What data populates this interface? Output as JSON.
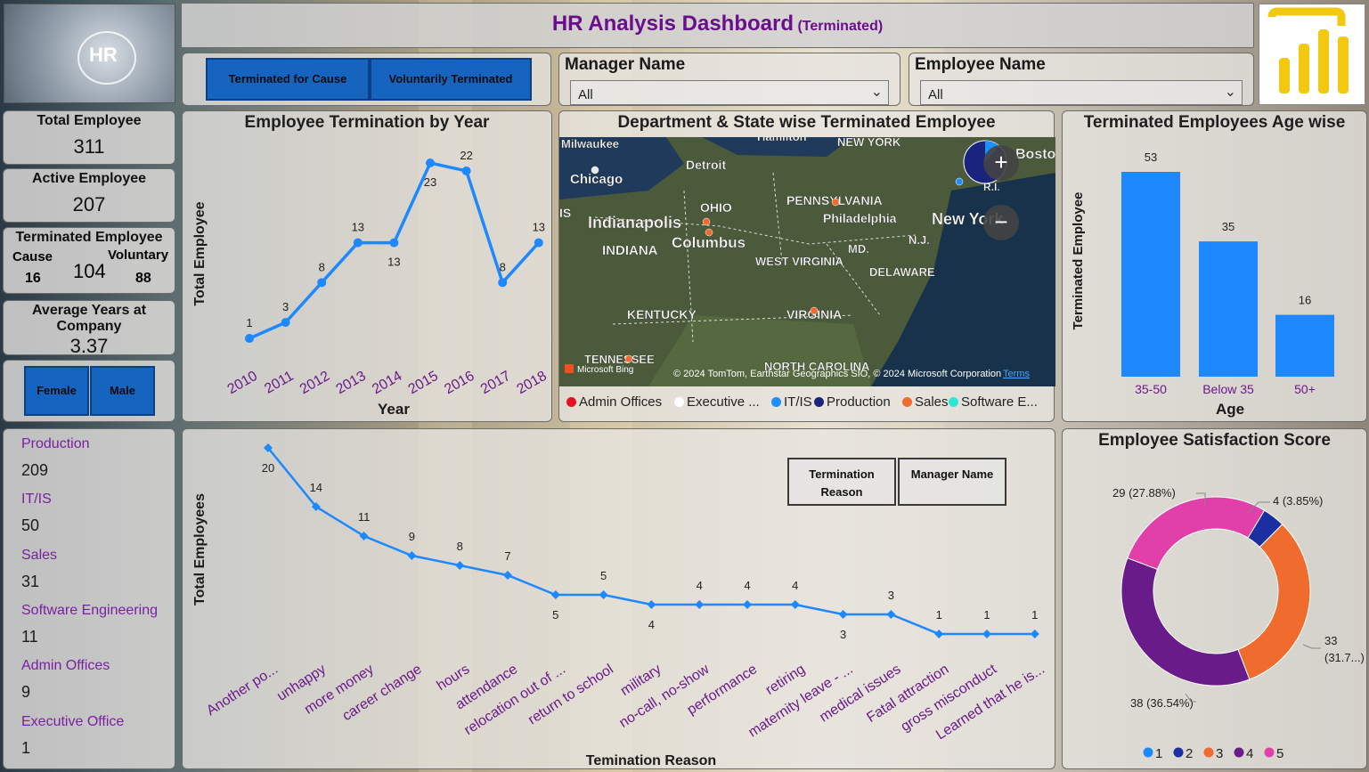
{
  "header": {
    "title": "HR Analysis Dashboard",
    "subtitle": "(Terminated)"
  },
  "logo": {
    "text": "HR"
  },
  "kpis": {
    "total_employee": {
      "label": "Total Employee",
      "value": "311"
    },
    "active_employee": {
      "label": "Active Employee",
      "value": "207"
    },
    "terminated": {
      "label": "Terminated Employee",
      "value": "104",
      "cause_label": "Cause",
      "cause_value": "16",
      "voluntary_label": "Voluntary",
      "voluntary_value": "88"
    },
    "avg_years": {
      "label_1": "Average Years at",
      "label_2": "Company",
      "value": "3.37"
    }
  },
  "buttons": {
    "terminated_for_cause": "Terminated for Cause",
    "voluntarily_terminated": "Voluntarily Terminated",
    "female": "Female",
    "male": "Male"
  },
  "filters": {
    "manager": {
      "label": "Manager Name",
      "value": "All"
    },
    "employee": {
      "label": "Employee Name",
      "value": "All"
    }
  },
  "departments": [
    {
      "name": "Production",
      "value": "209"
    },
    {
      "name": "IT/IS",
      "value": "50"
    },
    {
      "name": "Sales",
      "value": "31"
    },
    {
      "name": "Software Engineering",
      "value": "11"
    },
    {
      "name": "Admin Offices",
      "value": "9"
    },
    {
      "name": "Executive Office",
      "value": "1"
    }
  ],
  "map": {
    "title": "Department & State wise Terminated Employee",
    "labels": [
      "Milwaukee",
      "Hamilton",
      "NEW YORK",
      "Boston",
      "Detroit",
      "Chicago",
      "R.I.",
      "PENNSYLVANIA",
      "OHIO",
      "Philadelphia",
      "Indianapolis",
      "New York",
      "Columbus",
      "N.J.",
      "INDIANA",
      "MD.",
      "WEST VIRGINIA",
      "DELAWARE",
      "KENTUCKY",
      "VIRGINIA",
      "TENNESSEE",
      "NORTH CAROLINA",
      "IS"
    ],
    "attribution": "© 2024 TomTom, Earthstar Geographics SIO, © 2024 Microsoft Corporation",
    "terms": "Terms",
    "bing": "Microsoft Bing",
    "legend": [
      {
        "name": "Admin Offices",
        "color": "#e81123"
      },
      {
        "name": "Executive ...",
        "color": "#ffffff"
      },
      {
        "name": "IT/IS",
        "color": "#1e90ff"
      },
      {
        "name": "Production",
        "color": "#1a237e"
      },
      {
        "name": "Sales",
        "color": "#ef6c2e"
      },
      {
        "name": "Software E...",
        "color": "#2ee6d6"
      }
    ]
  },
  "chart_data": [
    {
      "type": "line",
      "title": "Employee Termination by Year",
      "xlabel": "Year",
      "ylabel": "Total Employee",
      "x": [
        "2010",
        "2011",
        "2012",
        "2013",
        "2014",
        "2015",
        "2016",
        "2017",
        "2018"
      ],
      "values": [
        1,
        3,
        8,
        13,
        13,
        23,
        22,
        8,
        13
      ],
      "color": "#1e88ff"
    },
    {
      "type": "bar",
      "title": "Terminated Employees Age wise",
      "xlabel": "Age",
      "ylabel": "Terminated Employee",
      "categories": [
        "35-50",
        "Below 35",
        "50+"
      ],
      "values": [
        53,
        35,
        16
      ],
      "color": "#1e88ff"
    },
    {
      "type": "line",
      "xlabel": "Temination Reason",
      "ylabel": "Total Employees",
      "x": [
        "Another po...",
        "unhappy",
        "more money",
        "career change",
        "hours",
        "attendance",
        "relocation out of ...",
        "return to school",
        "military",
        "no-call, no-show",
        "performance",
        "retiring",
        "maternity leave - ...",
        "medical issues",
        "Fatal attraction",
        "gross misconduct",
        "Learned that he is..."
      ],
      "values": [
        20,
        14,
        11,
        9,
        8,
        7,
        5,
        5,
        4,
        4,
        4,
        4,
        3,
        3,
        1,
        1,
        1
      ],
      "color": "#1e88ff",
      "buttons": [
        "Termination Reason",
        "Manager Name"
      ]
    },
    {
      "type": "pie",
      "title": "Employee Satisfaction Score",
      "categories": [
        "1",
        "2",
        "3",
        "4",
        "5"
      ],
      "values": [
        0,
        4,
        33,
        38,
        29
      ],
      "labels": [
        "",
        "4 (3.85%)",
        "33 (31.7...)",
        "38 (36.54%)",
        "29 (27.88%)"
      ],
      "colors": [
        "#1e88ff",
        "#1a2fa0",
        "#ef6c2e",
        "#6a1b8a",
        "#e040a8"
      ]
    }
  ]
}
